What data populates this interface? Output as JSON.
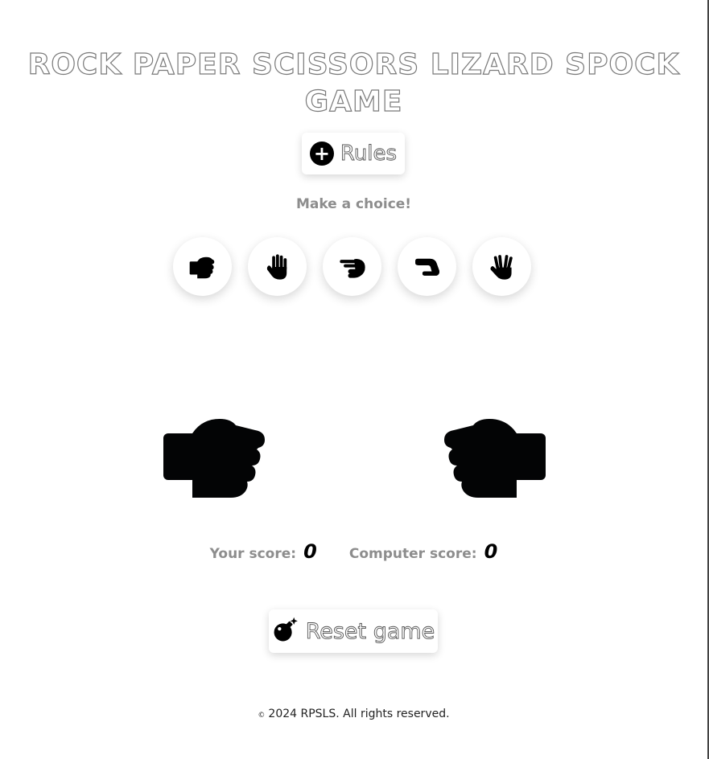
{
  "title": {
    "line1": "ROCK PAPER SCISSORS LIZARD SPOCK",
    "line2": "GAME"
  },
  "rules_button": {
    "icon": "plus-circle-icon",
    "label": "Rules"
  },
  "prompt": "Make a choice!",
  "choices": [
    {
      "icon": "rock-hand-icon"
    },
    {
      "icon": "paper-hand-icon"
    },
    {
      "icon": "scissors-hand-icon"
    },
    {
      "icon": "lizard-hand-icon"
    },
    {
      "icon": "spock-hand-icon"
    }
  ],
  "player_hand": {
    "icon": "rock-hand-icon"
  },
  "computer_hand": {
    "icon": "rock-hand-icon"
  },
  "scores": {
    "player_label": "Your score:",
    "player_value": "0",
    "computer_label": "Computer score:",
    "computer_value": "0"
  },
  "reset_button": {
    "icon": "bomb-icon",
    "label": "Reset game"
  },
  "footer": {
    "copyright_symbol": "©",
    "text": "2024 RPSLS. All rights reserved."
  }
}
